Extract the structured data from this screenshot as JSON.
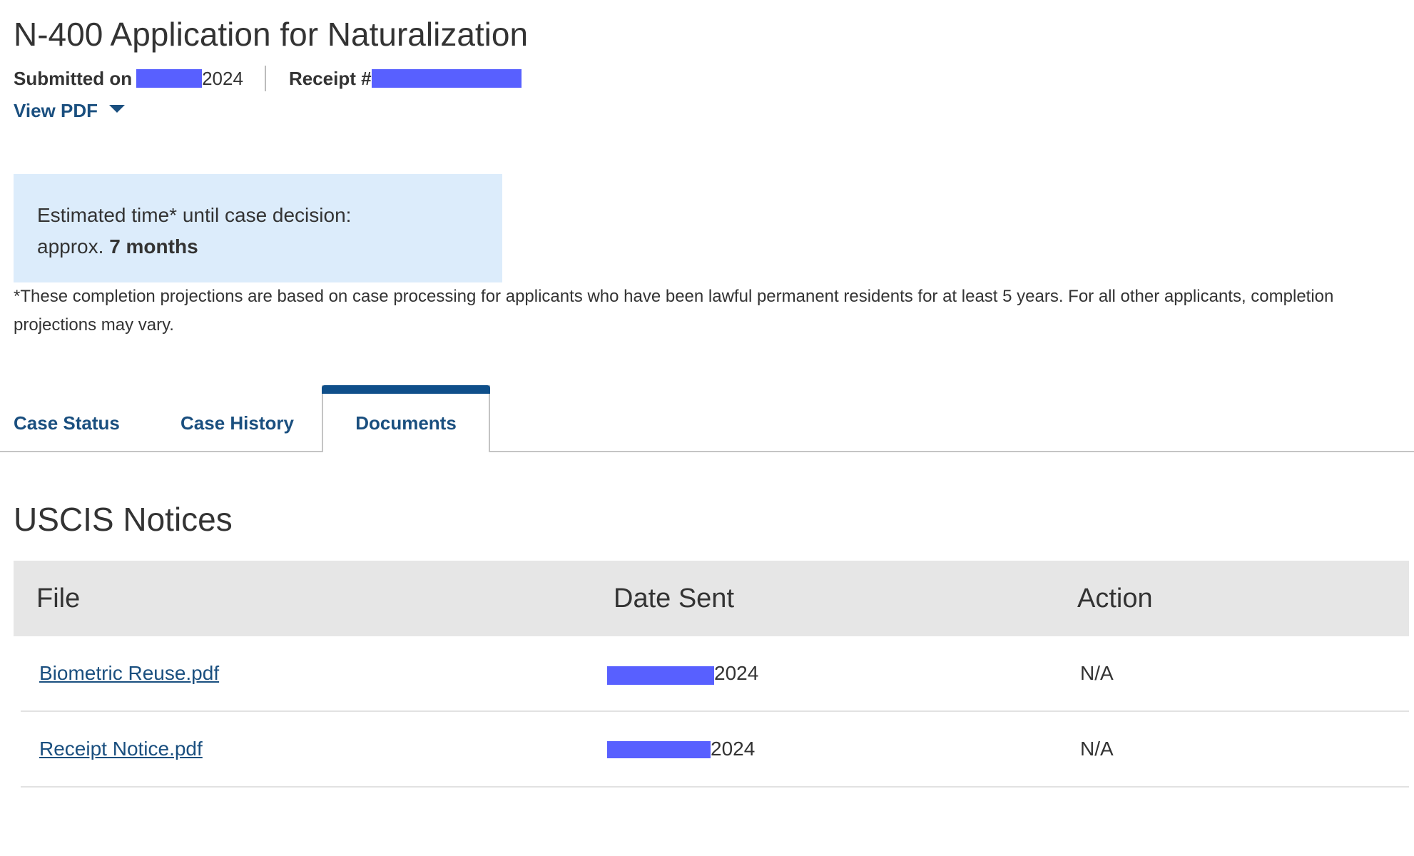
{
  "header": {
    "title": "N-400 Application for Naturalization",
    "submitted_label": "Submitted on",
    "submitted_date_visible": "2024",
    "receipt_label": "Receipt #",
    "view_pdf_label": "View PDF"
  },
  "estimate": {
    "line1": "Estimated time* until case decision:",
    "prefix": "approx.",
    "value": "7 months"
  },
  "footnote": "*These completion projections are based on case processing for applicants who have been lawful permanent residents for at least 5 years. For all other applicants, completion projections may vary.",
  "tabs": [
    {
      "label": "Case Status",
      "active": false
    },
    {
      "label": "Case History",
      "active": false
    },
    {
      "label": "Documents",
      "active": true
    }
  ],
  "notices": {
    "title": "USCIS Notices",
    "columns": [
      "File",
      "Date Sent",
      "Action"
    ],
    "rows": [
      {
        "file": "Biometric Reuse.pdf",
        "date_visible": "2024",
        "action": "N/A"
      },
      {
        "file": "Receipt Notice.pdf",
        "date_visible": "2024",
        "action": "N/A"
      }
    ]
  },
  "colors": {
    "link": "#1a4f7f",
    "active_tab_bar": "#0f4f8a",
    "estimate_bg": "#dcecfb",
    "table_header_bg": "#e6e6e6",
    "redaction": "#5860ff"
  }
}
